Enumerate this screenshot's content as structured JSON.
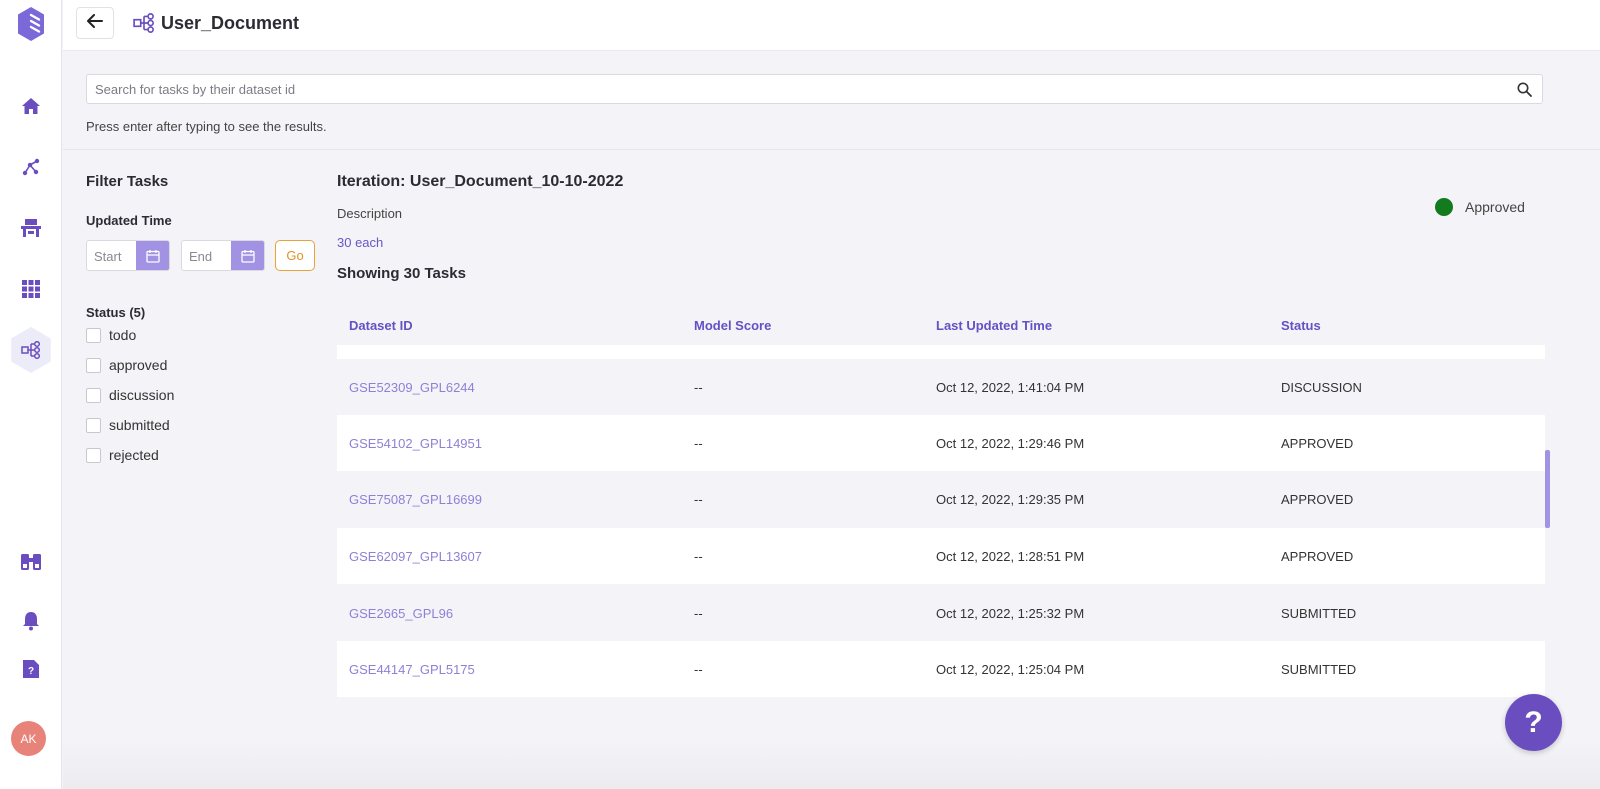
{
  "sidebar": {
    "icons": [
      {
        "name": "logo-icon"
      },
      {
        "name": "home-icon"
      },
      {
        "name": "graph-icon"
      },
      {
        "name": "workstation-icon"
      },
      {
        "name": "apps-grid-icon"
      },
      {
        "name": "workflow-icon",
        "active": true
      },
      {
        "name": "binoculars-icon"
      },
      {
        "name": "bell-icon"
      },
      {
        "name": "help-doc-icon"
      }
    ],
    "avatar_initials": "AK"
  },
  "header": {
    "title": "User_Document",
    "back_icon": "arrow-left-icon",
    "title_icon": "workflow-icon"
  },
  "search": {
    "placeholder": "Search for tasks by their dataset id",
    "value": "",
    "hint": "Press enter after typing to see the results."
  },
  "filters": {
    "title": "Filter Tasks",
    "updated_time_label": "Updated Time",
    "start_placeholder": "Start",
    "end_placeholder": "End",
    "go_label": "Go",
    "status_label": "Status (5)",
    "statuses": [
      "todo",
      "approved",
      "discussion",
      "submitted",
      "rejected"
    ]
  },
  "iteration": {
    "title": "Iteration: User_Document_10-10-2022",
    "description_label": "Description",
    "description_value": "30 each",
    "showing": "Showing 30 Tasks",
    "badge_label": "Approved",
    "badge_color": "#137a1e"
  },
  "table": {
    "columns": [
      "Dataset ID",
      "Model Score",
      "Last Updated Time",
      "Status"
    ],
    "rows": [
      {
        "id": "GSE52309_GPL6244",
        "score": "--",
        "time": "Oct 12, 2022, 1:41:04 PM",
        "status": "DISCUSSION"
      },
      {
        "id": "GSE54102_GPL14951",
        "score": "--",
        "time": "Oct 12, 2022, 1:29:46 PM",
        "status": "APPROVED"
      },
      {
        "id": "GSE75087_GPL16699",
        "score": "--",
        "time": "Oct 12, 2022, 1:29:35 PM",
        "status": "APPROVED"
      },
      {
        "id": "GSE62097_GPL13607",
        "score": "--",
        "time": "Oct 12, 2022, 1:28:51 PM",
        "status": "APPROVED"
      },
      {
        "id": "GSE2665_GPL96",
        "score": "--",
        "time": "Oct 12, 2022, 1:25:32 PM",
        "status": "SUBMITTED"
      },
      {
        "id": "GSE44147_GPL5175",
        "score": "--",
        "time": "Oct 12, 2022, 1:25:04 PM",
        "status": "SUBMITTED"
      }
    ]
  },
  "help_button": "?",
  "colors": {
    "accent": "#6a55c8",
    "calendar_button": "#a292e3",
    "go_button": "#e0922a"
  }
}
